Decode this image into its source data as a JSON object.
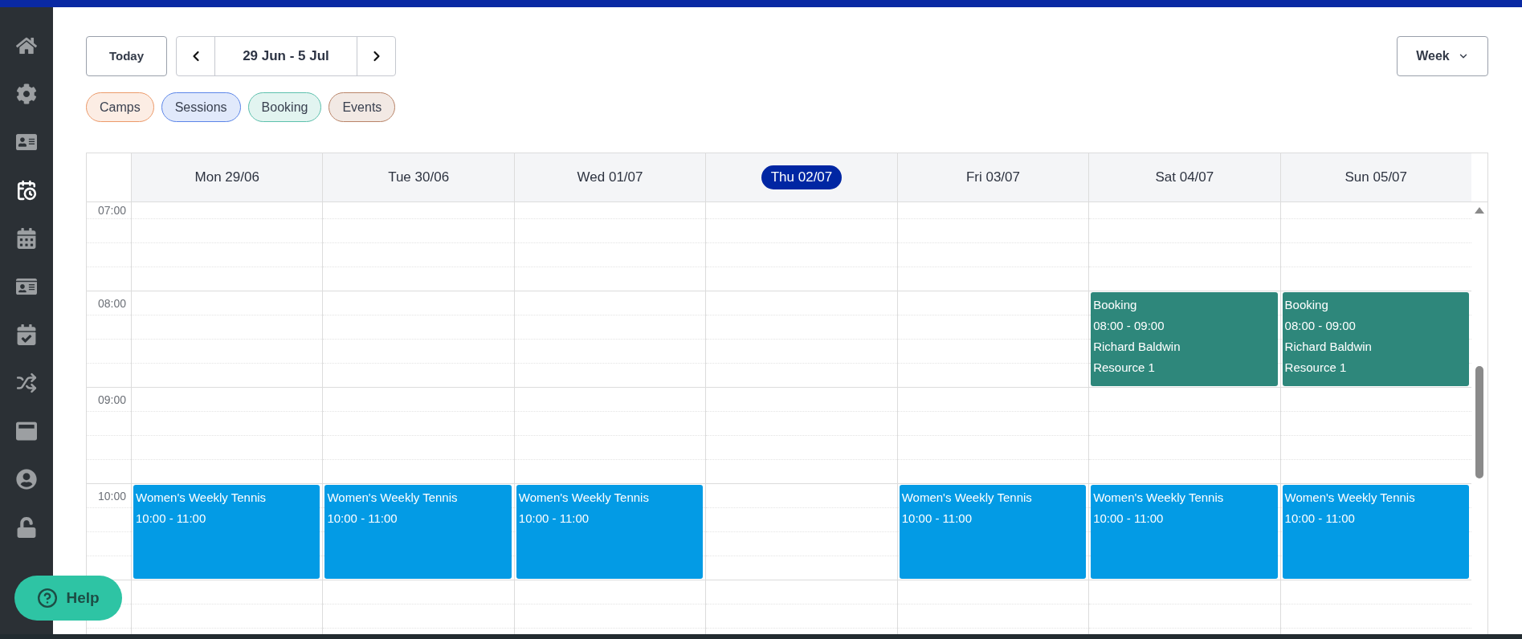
{
  "sidebar": {
    "items": [
      {
        "selected": false
      },
      {
        "selected": false
      },
      {
        "selected": false
      },
      {
        "selected": true
      },
      {
        "selected": false
      },
      {
        "selected": false
      },
      {
        "selected": false
      },
      {
        "selected": false
      },
      {
        "selected": false
      },
      {
        "selected": false
      },
      {
        "selected": false
      }
    ]
  },
  "toolbar": {
    "today_button": "Today",
    "date_range": "29 Jun - 5 Jul",
    "view_select": "Week"
  },
  "filters": [
    {
      "label": "Camps",
      "color": "#ec9a6a"
    },
    {
      "label": "Sessions",
      "color": "#5b85e8"
    },
    {
      "label": "Booking",
      "color": "#5cc0ac"
    },
    {
      "label": "Events",
      "color": "#b98468"
    }
  ],
  "calendar": {
    "time_labels": [
      "07:00",
      "08:00",
      "09:00",
      "10:00"
    ],
    "days": [
      {
        "label": "Mon 29/06",
        "today": false,
        "events": [
          {
            "title": "Women's Weekly Tennis",
            "time": "10:00 - 11:00",
            "color": "#039be5"
          }
        ]
      },
      {
        "label": "Tue 30/06",
        "today": false,
        "events": [
          {
            "title": "Women's Weekly Tennis",
            "time": "10:00 - 11:00",
            "color": "#039be5"
          }
        ]
      },
      {
        "label": "Wed 01/07",
        "today": false,
        "events": [
          {
            "title": "Women's Weekly Tennis",
            "time": "10:00 - 11:00",
            "color": "#039be5"
          }
        ]
      },
      {
        "label": "Thu 02/07",
        "today": true
      },
      {
        "label": "Fri 03/07",
        "today": false,
        "events": [
          {
            "title": "Women's Weekly Tennis",
            "time": "10:00 - 11:00",
            "color": "#039be5"
          }
        ]
      },
      {
        "label": "Sat 04/07",
        "today": false,
        "events": [
          {
            "title": "Booking",
            "time": "08:00 - 09:00",
            "details": [
              "Richard Baldwin",
              "Resource 1"
            ],
            "color": "#2e877b"
          },
          {
            "title": "Women's Weekly Tennis",
            "time": "10:00 - 11:00",
            "color": "#039be5"
          }
        ]
      },
      {
        "label": "Sun 05/07",
        "today": false,
        "events": [
          {
            "title": "Booking",
            "time": "08:00 - 09:00",
            "details": [
              "Richard Baldwin",
              "Resource 1"
            ],
            "color": "#2e877b"
          },
          {
            "title": "Women's Weekly Tennis",
            "time": "10:00 - 11:00",
            "color": "#039be5"
          }
        ]
      }
    ]
  },
  "help_button": "Help"
}
